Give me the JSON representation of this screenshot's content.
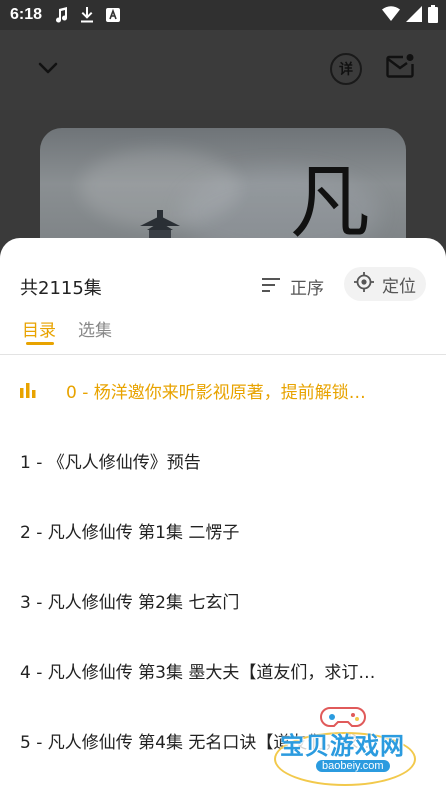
{
  "status_bar": {
    "time": "6:18"
  },
  "header": {
    "detail_label": "详"
  },
  "cover": {
    "calligraphy": "凡"
  },
  "sheet": {
    "episode_count": "共2115集",
    "sort_label": "正序",
    "locate_label": "定位",
    "tabs": [
      {
        "label": "目录",
        "active": true
      },
      {
        "label": "选集",
        "active": false
      }
    ]
  },
  "episodes": [
    {
      "title": "0 - 杨洋邀你来听影视原著，提前解锁…",
      "playing": true
    },
    {
      "title": "1 - 《凡人修仙传》预告",
      "playing": false
    },
    {
      "title": "2 - 凡人修仙传 第1集 二愣子",
      "playing": false
    },
    {
      "title": "3 - 凡人修仙传 第2集 七玄门",
      "playing": false
    },
    {
      "title": "4 - 凡人修仙传 第3集 墨大夫【道友们，求订…",
      "playing": false
    },
    {
      "title": "5 - 凡人修仙传 第4集 无名口诀【道友们，求…",
      "playing": false
    }
  ],
  "watermark": {
    "text": "宝贝游戏网",
    "url": "baobeiy.com"
  },
  "colors": {
    "accent": "#e8a300",
    "background_dim": "#3a3a3a",
    "sheet": "#ffffff"
  }
}
